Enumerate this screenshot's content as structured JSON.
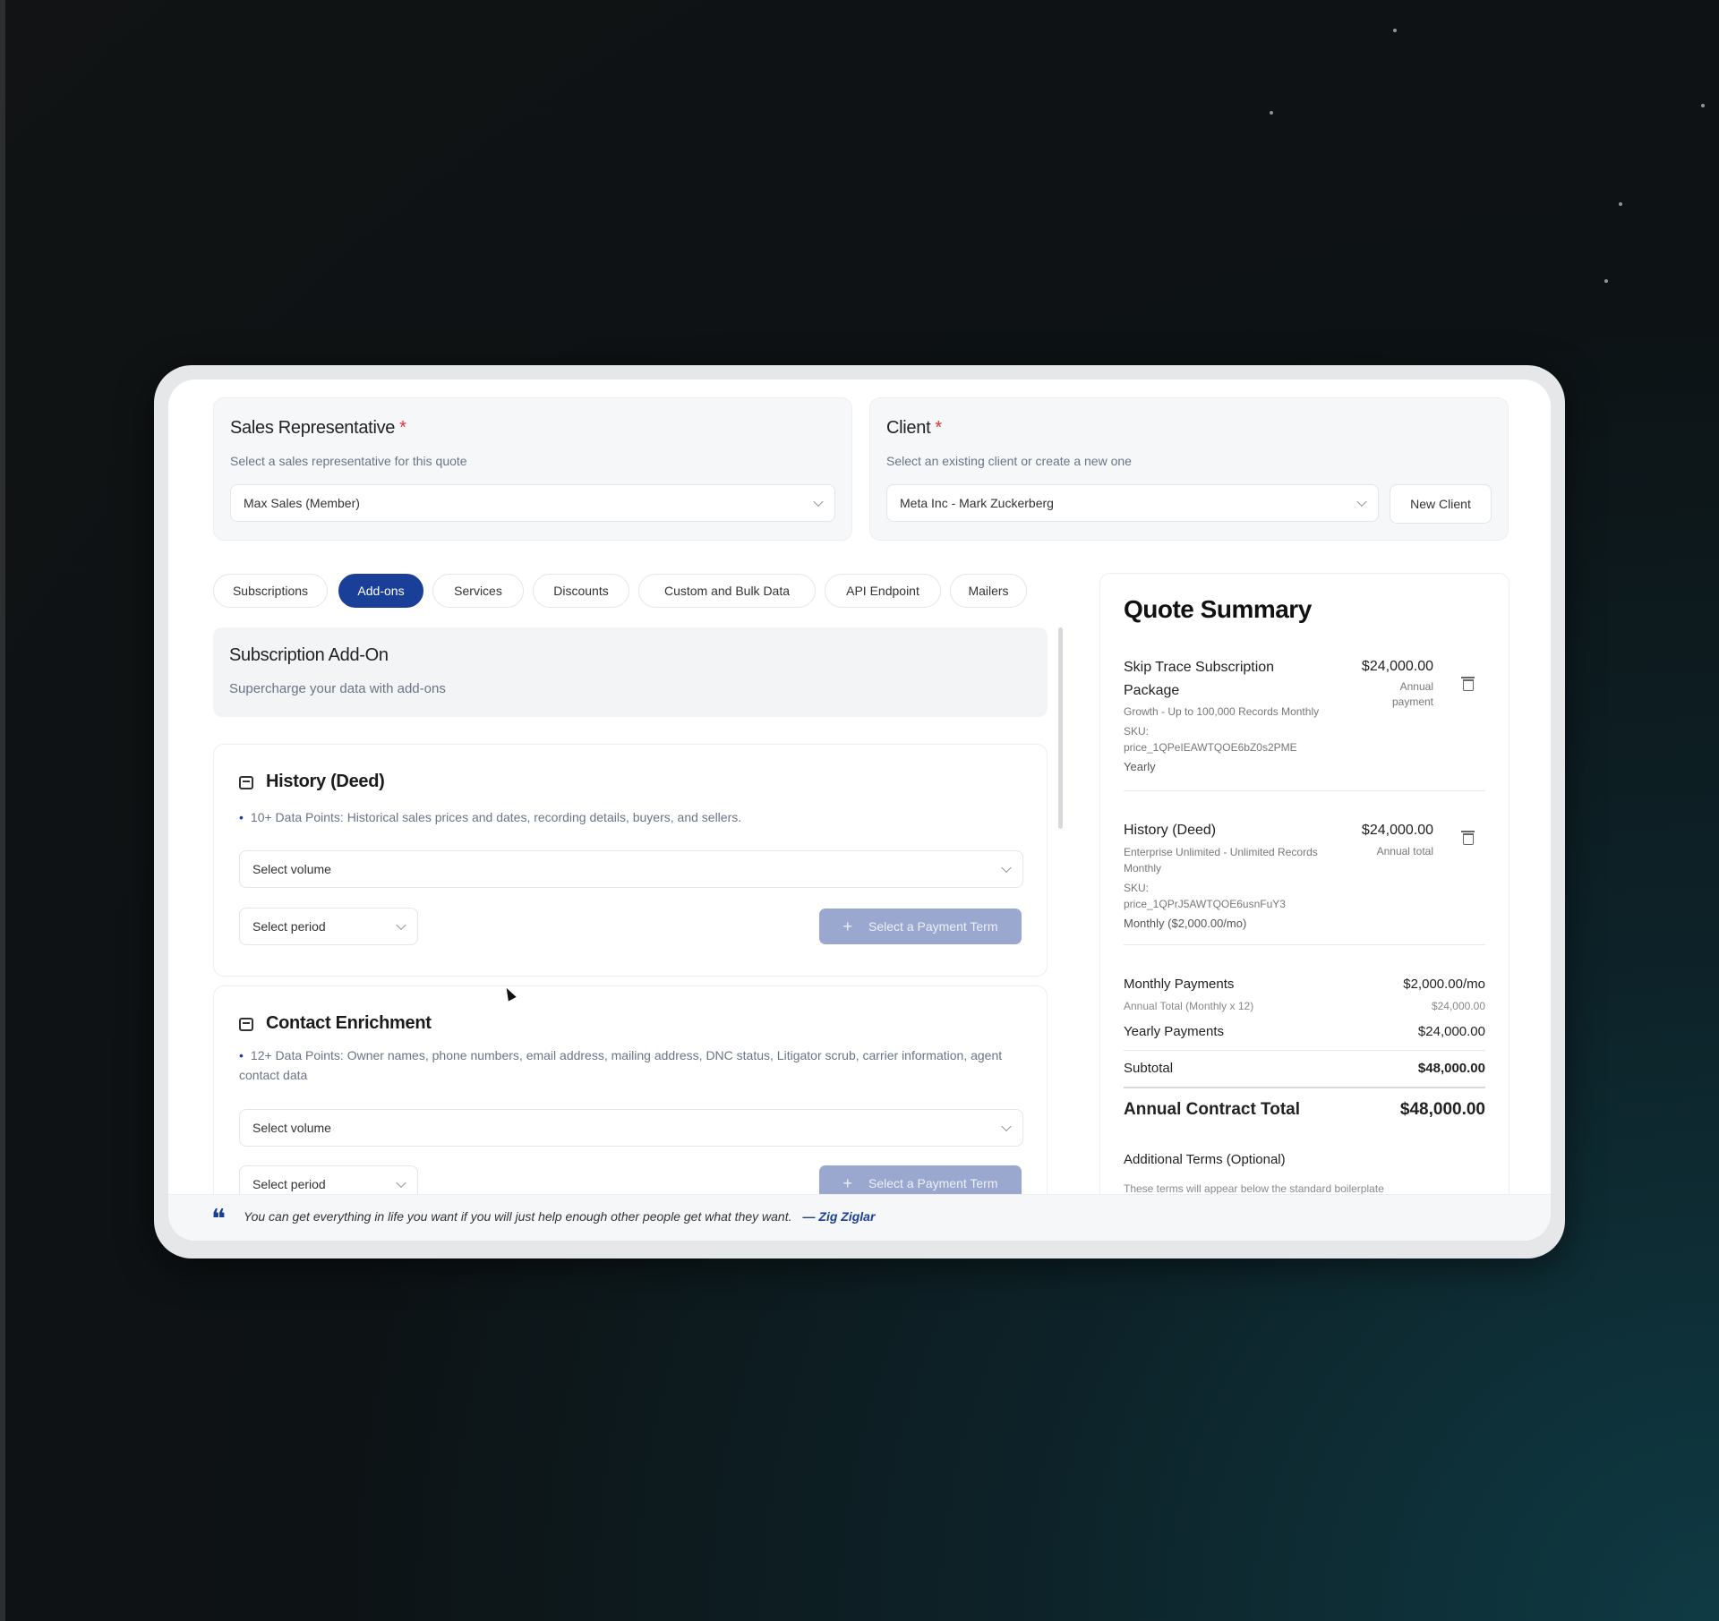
{
  "sales_rep": {
    "title": "Sales Representative",
    "required_mark": "*",
    "subtitle": "Select a sales representative for this quote",
    "value": "Max Sales (Member)"
  },
  "client": {
    "title": "Client",
    "required_mark": "*",
    "subtitle": "Select an existing client or create a new one",
    "value": "Meta Inc - Mark Zuckerberg",
    "new_button": "New Client"
  },
  "tabs": [
    {
      "label": "Subscriptions",
      "active": false
    },
    {
      "label": "Add-ons",
      "active": true
    },
    {
      "label": "Services",
      "active": false
    },
    {
      "label": "Discounts",
      "active": false
    },
    {
      "label": "Custom and Bulk Data",
      "active": false
    },
    {
      "label": "API Endpoint",
      "active": false
    },
    {
      "label": "Mailers",
      "active": false
    }
  ],
  "addon_header": {
    "title": "Subscription Add-On",
    "subtitle": "Supercharge your data with add-ons"
  },
  "addons": [
    {
      "title": "History (Deed)",
      "description": "10+ Data Points: Historical sales prices and dates, recording details, buyers, and sellers.",
      "volume_placeholder": "Select volume",
      "period_placeholder": "Select period",
      "button": "Select a Payment Term"
    },
    {
      "title": "Contact Enrichment",
      "description": "12+ Data Points: Owner names, phone numbers, email address, mailing address, DNC status, Litigator scrub, carrier information, agent contact data",
      "volume_placeholder": "Select volume",
      "period_placeholder": "Select period",
      "button": "Select a Payment Term"
    }
  ],
  "summary": {
    "title": "Quote Summary",
    "items": [
      {
        "name_line1": "Skip Trace Subscription",
        "name_line2": "Package",
        "amount": "$24,000.00",
        "amount_sub_line1": "Annual",
        "amount_sub_line2": "payment",
        "detail": "Growth - Up to 100,000 Records Monthly",
        "sku_label": "SKU:",
        "sku": "price_1QPeIEAWTQOE6bZ0s2PME",
        "term": "Yearly"
      },
      {
        "name_line1": "History (Deed)",
        "amount": "$24,000.00",
        "amount_sub_line1": "Annual total",
        "detail_line1": "Enterprise Unlimited - Unlimited Records",
        "detail_line2": "Monthly",
        "sku_label": "SKU:",
        "sku": "price_1QPrJ5AWTQOE6usnFuY3",
        "term": "Monthly ($2,000.00/mo)"
      }
    ],
    "monthly_payments_label": "Monthly Payments",
    "monthly_payments_value": "$2,000.00/mo",
    "annual_total_label": "Annual Total (Monthly x 12)",
    "annual_total_value": "$24,000.00",
    "yearly_payments_label": "Yearly Payments",
    "yearly_payments_value": "$24,000.00",
    "subtotal_label": "Subtotal",
    "subtotal_value": "$48,000.00",
    "contract_total_label": "Annual Contract Total",
    "contract_total_value": "$48,000.00",
    "additional_terms_label": "Additional Terms (Optional)",
    "additional_terms_hint": "These terms will appear below the standard boilerplate"
  },
  "footer": {
    "quote": "You can get everything in life you want if you will just help enough other people get what they want.",
    "author": "— Zig Ziglar"
  },
  "colors": {
    "accent": "#1a3f98",
    "accent_disabled": "#9aa7cf",
    "required": "#d9343c"
  }
}
